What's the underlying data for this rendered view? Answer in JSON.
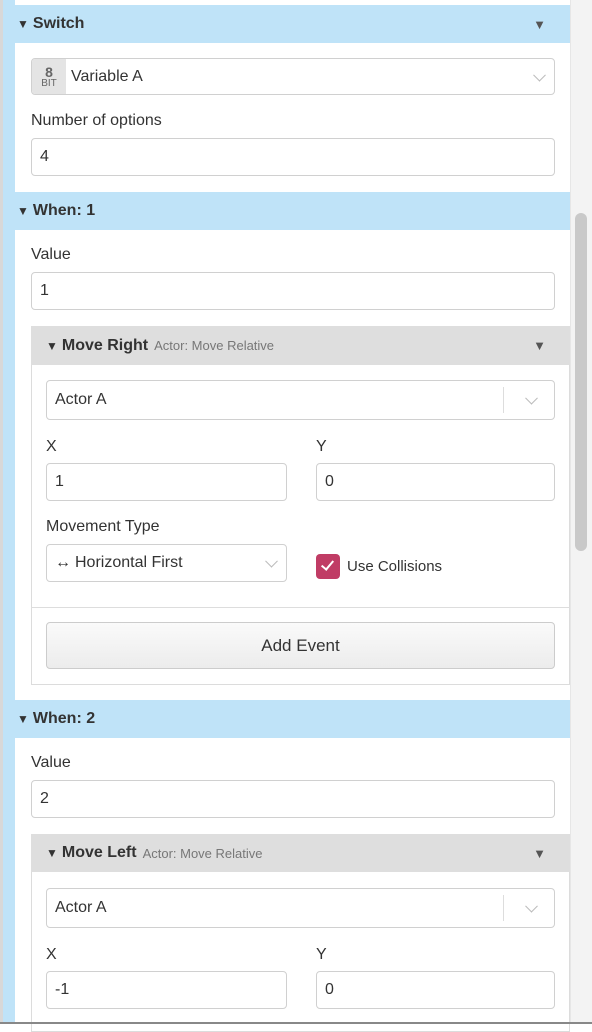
{
  "switch": {
    "title": "Switch",
    "variable_badge_top": "8",
    "variable_badge_bottom": "BIT",
    "variable": "Variable A",
    "options_label": "Number of options",
    "options_value": "4"
  },
  "cases": [
    {
      "title": "When: 1",
      "value_label": "Value",
      "value": "1",
      "event": {
        "title": "Move Right",
        "subtitle": "Actor: Move Relative",
        "actor": "Actor A",
        "x_label": "X",
        "x": "1",
        "y_label": "Y",
        "y": "0",
        "movement_label": "Movement Type",
        "movement_icon": "↔",
        "movement": "Horizontal First",
        "collisions_label": "Use Collisions",
        "collisions_checked": true
      },
      "add_event": "Add Event"
    },
    {
      "title": "When: 2",
      "value_label": "Value",
      "value": "2",
      "event": {
        "title": "Move Left",
        "subtitle": "Actor: Move Relative",
        "actor": "Actor A",
        "x_label": "X",
        "x": "-1",
        "y_label": "Y",
        "y": "0"
      }
    }
  ],
  "icons": {
    "collapse": "▼",
    "menu": "▼"
  },
  "colors": {
    "header_blue": "#bfe3f8",
    "checkbox": "#c03c65"
  }
}
